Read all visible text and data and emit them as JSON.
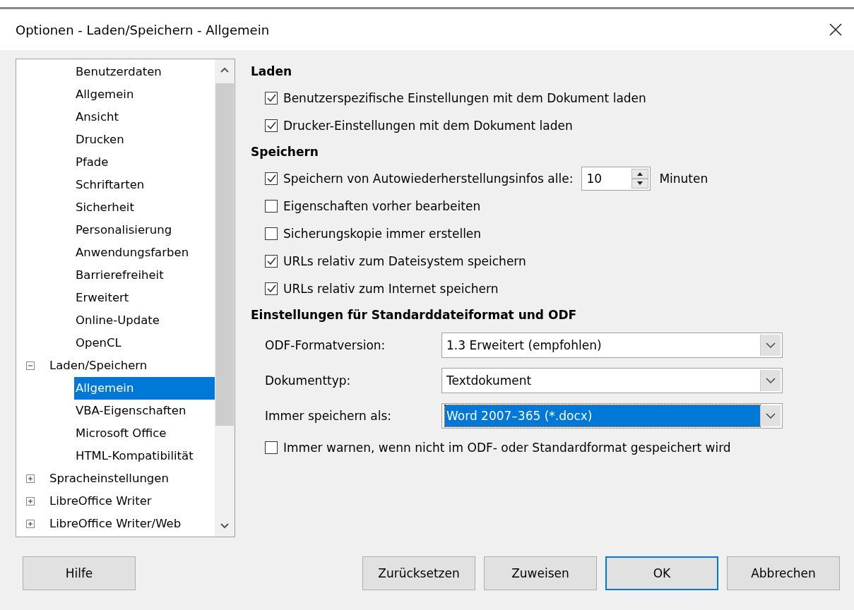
{
  "window": {
    "title": "Optionen - Laden/Speichern - Allgemein"
  },
  "tree": {
    "continued_children": [
      {
        "label": "Benutzerdaten",
        "selected": false
      },
      {
        "label": "Allgemein",
        "selected": false
      },
      {
        "label": "Ansicht",
        "selected": false
      },
      {
        "label": "Drucken",
        "selected": false
      },
      {
        "label": "Pfade",
        "selected": false
      },
      {
        "label": "Schriftarten",
        "selected": false
      },
      {
        "label": "Sicherheit",
        "selected": false
      },
      {
        "label": "Personalisierung",
        "selected": false
      },
      {
        "label": "Anwendungsfarben",
        "selected": false
      },
      {
        "label": "Barrierefreiheit",
        "selected": false
      },
      {
        "label": "Erweitert",
        "selected": false
      },
      {
        "label": "Online-Update",
        "selected": false
      },
      {
        "label": "OpenCL",
        "selected": false
      }
    ],
    "items": [
      {
        "label": "Laden/Speichern",
        "selected": false,
        "expanded": true,
        "children": [
          {
            "label": "Allgemein",
            "selected": true
          },
          {
            "label": "VBA-Eigenschaften",
            "selected": false
          },
          {
            "label": "Microsoft Office",
            "selected": false
          },
          {
            "label": "HTML-Kompatibilität",
            "selected": false
          }
        ]
      },
      {
        "label": "Spracheinstellungen",
        "selected": false,
        "expanded": false
      },
      {
        "label": "LibreOffice Writer",
        "selected": false,
        "expanded": false
      },
      {
        "label": "LibreOffice Writer/Web",
        "selected": false,
        "expanded": false
      }
    ]
  },
  "sections": [
    {
      "title": "Laden",
      "rows": [
        {
          "kind": "checkbox",
          "label": "Benutzerspezifische Einstellungen mit dem Dokument laden",
          "checked": true
        },
        {
          "kind": "checkbox",
          "label": "Drucker-Einstellungen mit dem Dokument laden",
          "checked": true
        }
      ]
    },
    {
      "title": "Speichern",
      "rows": [
        {
          "kind": "spin",
          "label": "Speichern von Autowiederherstellungsinfos alle:",
          "checked": true,
          "value": "10",
          "unit": "Minuten"
        },
        {
          "kind": "checkbox",
          "label": "Eigenschaften vorher bearbeiten",
          "checked": false
        },
        {
          "kind": "checkbox",
          "label": "Sicherungskopie immer erstellen",
          "checked": false
        },
        {
          "kind": "checkbox",
          "label": "URLs relativ zum Dateisystem speichern",
          "checked": true
        },
        {
          "kind": "checkbox",
          "label": "URLs relativ zum Internet speichern",
          "checked": true
        }
      ]
    },
    {
      "title": "Einstellungen für Standarddateiformat und ODF",
      "rows": [
        {
          "kind": "dropdown",
          "label": "ODF-Formatversion:",
          "value": "1.3 Erweitert (empfohlen)",
          "focused": false
        },
        {
          "kind": "dropdown",
          "label": "Dokumenttyp:",
          "value": "Textdokument",
          "focused": false
        },
        {
          "kind": "dropdown",
          "label": "Immer speichern als:",
          "value": "Word 2007–365 (*.docx)",
          "focused": true
        },
        {
          "kind": "checkbox",
          "label": "Immer warnen, wenn nicht im ODF- oder Standardformat gespeichert wird",
          "checked": false
        }
      ]
    }
  ],
  "buttons": [
    {
      "label": "Hilfe",
      "kind": "help",
      "default": false
    },
    {
      "label": "Zurücksetzen",
      "kind": "action",
      "default": false
    },
    {
      "label": "Zuweisen",
      "kind": "action",
      "default": false
    },
    {
      "label": "OK",
      "kind": "action",
      "default": true
    },
    {
      "label": "Abbrechen",
      "kind": "action",
      "default": false
    }
  ]
}
